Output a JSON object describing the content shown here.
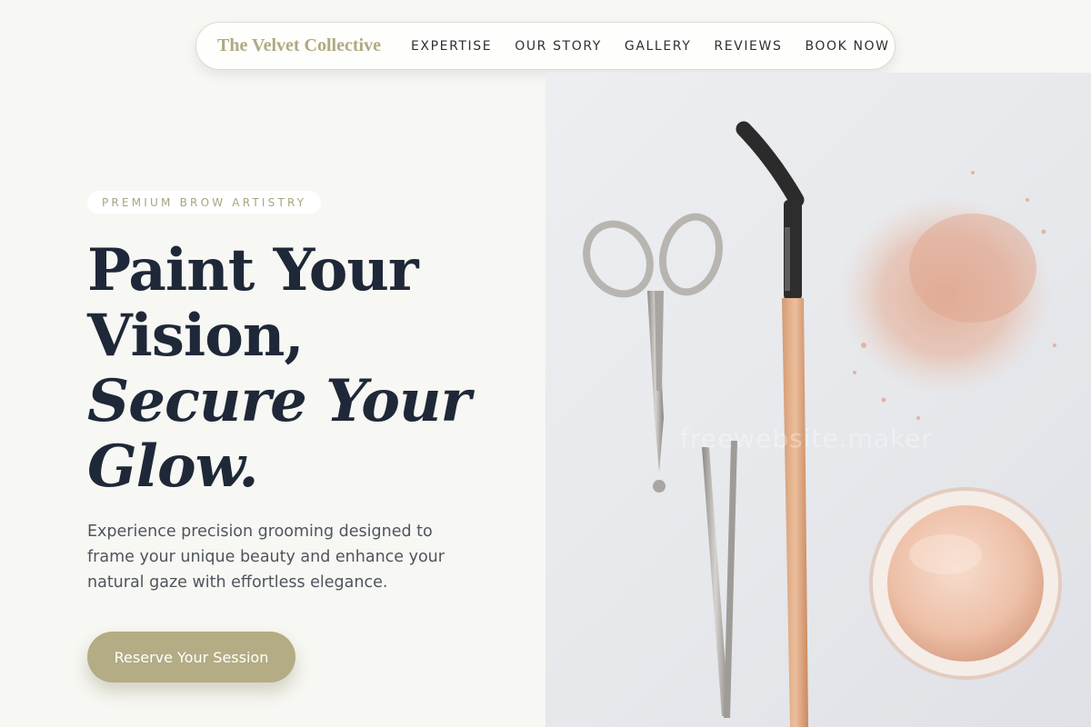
{
  "nav": {
    "brand": "The Velvet Collective",
    "links": [
      "EXPERTISE",
      "OUR STORY",
      "GALLERY",
      "REVIEWS",
      "BOOK NOW"
    ]
  },
  "hero": {
    "eyebrow": "PREMIUM BROW ARTISTRY",
    "headline": [
      "Paint Your",
      "Vision,",
      "Secure Your",
      "Glow."
    ],
    "subtext": "Experience precision grooming designed to frame your unique beauty and enhance your natural gaze with effortless elegance.",
    "cta_label": "Reserve Your Session"
  },
  "image": {
    "watermark": "freewebsite.maker"
  },
  "colors": {
    "background": "#f7f7f3",
    "accent": "#b3ac84",
    "brand_text": "#b0a982",
    "headline": "#1f2838"
  }
}
